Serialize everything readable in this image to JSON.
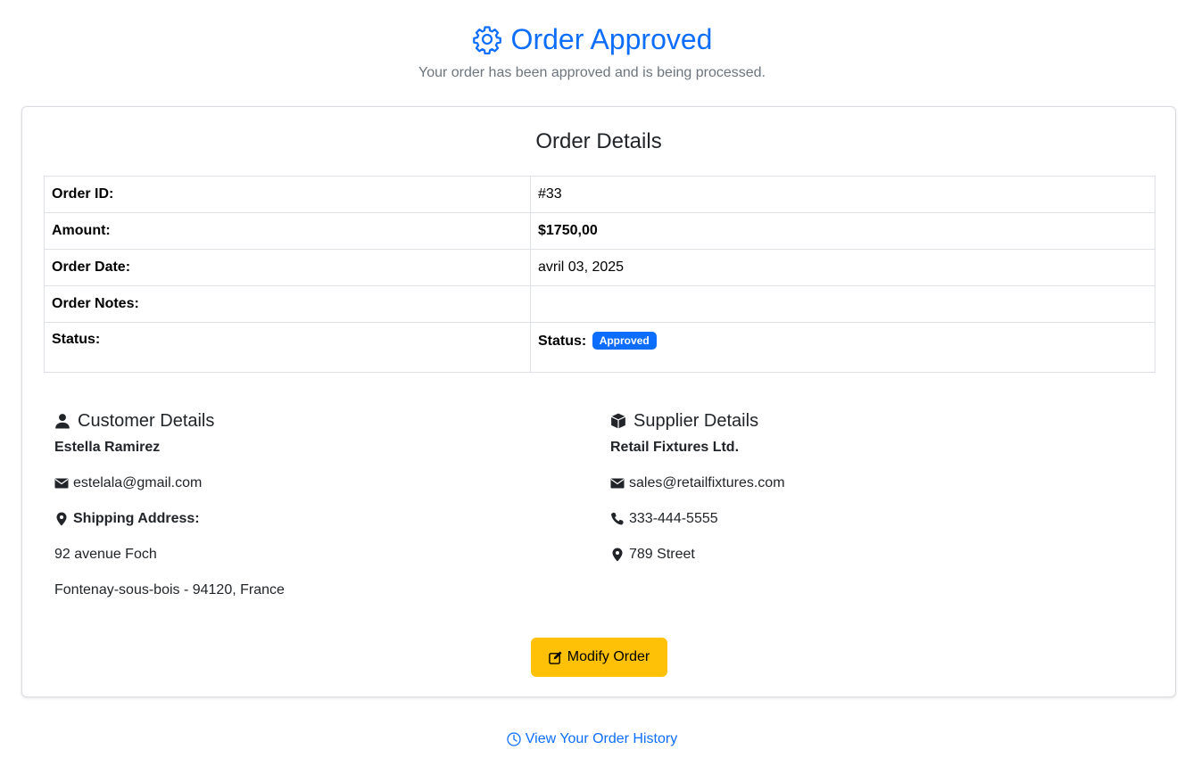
{
  "header": {
    "title": "Order Approved",
    "subtitle": "Your order has been approved and is being processed."
  },
  "card": {
    "title": "Order Details",
    "rows": [
      {
        "label": "Order ID:",
        "value": "#33"
      },
      {
        "label": "Amount:",
        "value": "$1750,00"
      },
      {
        "label": "Order Date:",
        "value": "avril 03, 2025"
      },
      {
        "label": "Order Notes:",
        "value": ""
      },
      {
        "label": "Status:",
        "value_label": "Status:",
        "badge": "Approved"
      }
    ]
  },
  "customer": {
    "heading": "Customer Details",
    "name": "Estella Ramirez",
    "email": "estelala@gmail.com",
    "shipping_label": "Shipping Address:",
    "address_line1": "92 avenue Foch",
    "address_line2": "Fontenay-sous-bois - 94120, France"
  },
  "supplier": {
    "heading": "Supplier Details",
    "name": "Retail Fixtures Ltd.",
    "email": "sales@retailfixtures.com",
    "phone": "333-444-5555",
    "address": "789 Street"
  },
  "actions": {
    "modify_label": "Modify Order",
    "history_label": "View Your Order History"
  },
  "colors": {
    "primary": "#0d6efd",
    "warning": "#ffc107",
    "muted": "#6c757d"
  },
  "icons": {
    "title": "gear-icon",
    "customer": "user-icon",
    "supplier": "box-icon",
    "email": "envelope-icon",
    "location": "map-pin-icon",
    "phone": "phone-icon",
    "modify": "edit-icon",
    "history": "clock-icon"
  }
}
